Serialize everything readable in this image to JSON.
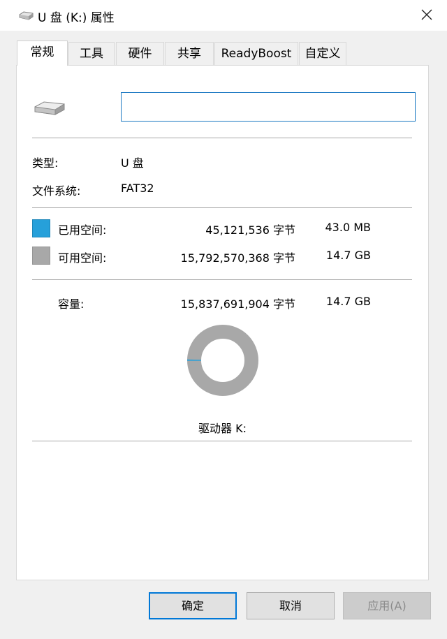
{
  "window": {
    "title": "U 盘 (K:) 属性",
    "close_icon": "close-icon"
  },
  "tabs": [
    {
      "label": "常规",
      "active": true
    },
    {
      "label": "工具"
    },
    {
      "label": "硬件"
    },
    {
      "label": "共享"
    },
    {
      "label": "ReadyBoost"
    },
    {
      "label": "自定义"
    }
  ],
  "general": {
    "drive_icon": "usb-drive-icon",
    "volume_label_value": "",
    "type_label": "类型:",
    "type_value": "U 盘",
    "fs_label": "文件系统:",
    "fs_value": "FAT32",
    "used_label": "已用空间:",
    "used_bytes": "45,121,536 字节",
    "used_size": "43.0 MB",
    "free_label": "可用空间:",
    "free_bytes": "15,792,570,368 字节",
    "free_size": "14.7 GB",
    "capacity_label": "容量:",
    "capacity_bytes": "15,837,691,904 字节",
    "capacity_size": "14.7 GB",
    "drive_caption": "驱动器 K:",
    "used_fraction": 0.0028,
    "colors": {
      "used": "#26a0da",
      "free": "#a8a8a8"
    }
  },
  "buttons": {
    "ok": "确定",
    "cancel": "取消",
    "apply": "应用(A)"
  }
}
